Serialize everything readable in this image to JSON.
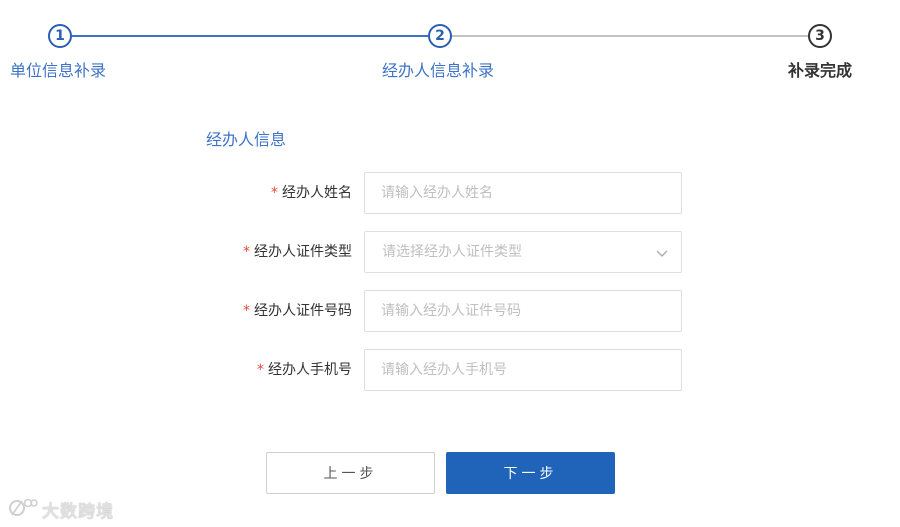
{
  "stepper": {
    "steps": [
      {
        "number": "1",
        "label": "单位信息补录",
        "state": "done"
      },
      {
        "number": "2",
        "label": "经办人信息补录",
        "state": "current"
      },
      {
        "number": "3",
        "label": "补录完成",
        "state": "pending"
      }
    ]
  },
  "form": {
    "section_title": "经办人信息",
    "required_mark": "*",
    "fields": [
      {
        "label": "经办人姓名",
        "placeholder": "请输入经办人姓名",
        "type": "text",
        "value": ""
      },
      {
        "label": "经办人证件类型",
        "placeholder": "请选择经办人证件类型",
        "type": "select",
        "value": "",
        "icon": "chevron-down-icon"
      },
      {
        "label": "经办人证件号码",
        "placeholder": "请输入经办人证件号码",
        "type": "text",
        "value": ""
      },
      {
        "label": "经办人手机号",
        "placeholder": "请输入经办人手机号",
        "type": "text",
        "value": ""
      }
    ]
  },
  "actions": {
    "prev_label": "上一步",
    "next_label": "下一步"
  },
  "watermark": {
    "text": "大数跨境"
  },
  "colors": {
    "accent": "#3e73c6",
    "primary_button": "#1f64b8",
    "required": "#e84a3b"
  }
}
